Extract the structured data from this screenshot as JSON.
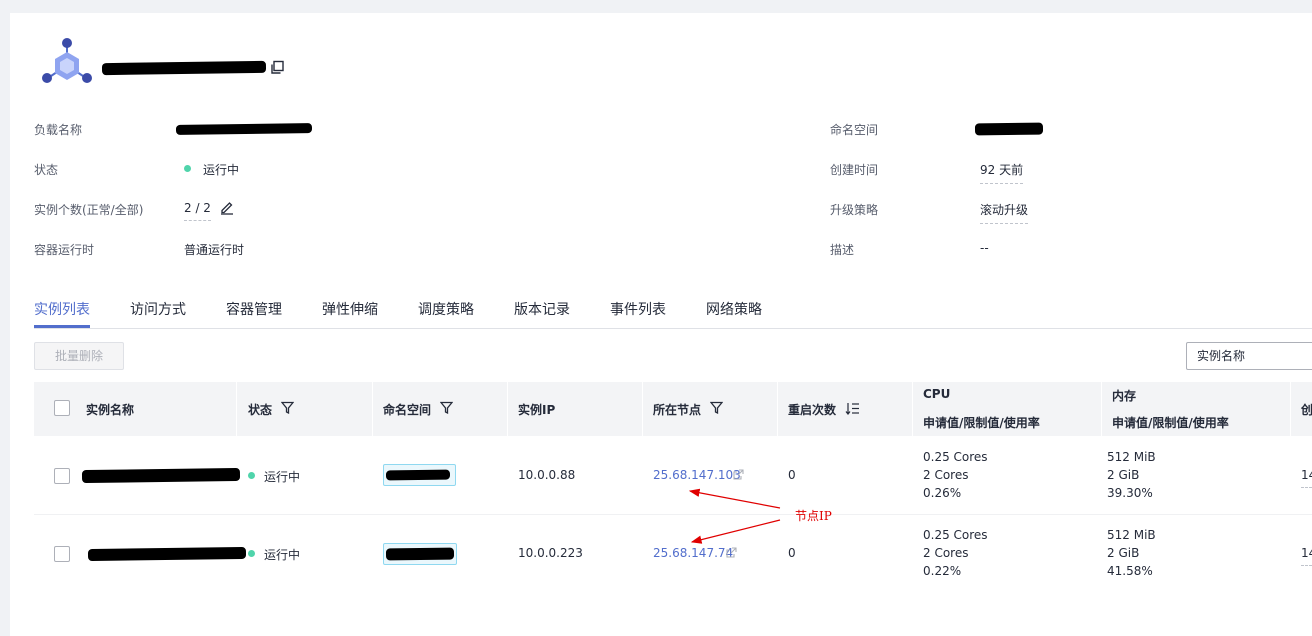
{
  "header": {
    "copy_icon": "copy-icon",
    "logo_icon": "workload-hexagon-icon"
  },
  "info": {
    "left": [
      {
        "label": "负载名称",
        "value": ""
      },
      {
        "label": "状态",
        "value": "运行中"
      },
      {
        "label": "实例个数(正常/全部)",
        "value": "2 / 2"
      },
      {
        "label": "容器运行时",
        "value": "普通运行时"
      }
    ],
    "right": [
      {
        "label": "命名空间",
        "value": ""
      },
      {
        "label": "创建时间",
        "value": "92 天前"
      },
      {
        "label": "升级策略",
        "value": "滚动升级"
      },
      {
        "label": "描述",
        "value": "--"
      }
    ]
  },
  "tabs": [
    "实例列表",
    "访问方式",
    "容器管理",
    "弹性伸缩",
    "调度策略",
    "版本记录",
    "事件列表",
    "网络策略"
  ],
  "toolbar": {
    "batch_delete": "批量删除",
    "search_select": "实例名称"
  },
  "table": {
    "headers": {
      "name": "实例名称",
      "status": "状态",
      "namespace": "命名空间",
      "ip": "实例IP",
      "node": "所在节点",
      "restarts": "重启次数",
      "cpu": "CPU",
      "cpu_sub": "申请值/限制值/使用率",
      "mem": "内存",
      "mem_sub": "申请值/限制值/使用率",
      "created": "创"
    },
    "rows": [
      {
        "status": "运行中",
        "ip": "10.0.0.88",
        "node": "25.68.147.103",
        "restarts": "0",
        "cpu": [
          "0.25 Cores",
          "2 Cores",
          "0.26%"
        ],
        "mem": [
          "512 MiB",
          "2 GiB",
          "39.30%"
        ],
        "created": "14"
      },
      {
        "status": "运行中",
        "ip": "10.0.0.223",
        "node": "25.68.147.74",
        "restarts": "0",
        "cpu": [
          "0.25 Cores",
          "2 Cores",
          "0.22%"
        ],
        "mem": [
          "512 MiB",
          "2 GiB",
          "41.58%"
        ],
        "created": "14"
      }
    ]
  },
  "annotation": {
    "text": "节点IP",
    "color": "#e00000"
  },
  "colors": {
    "accent": "#526ecc",
    "running": "#50d4ab"
  }
}
